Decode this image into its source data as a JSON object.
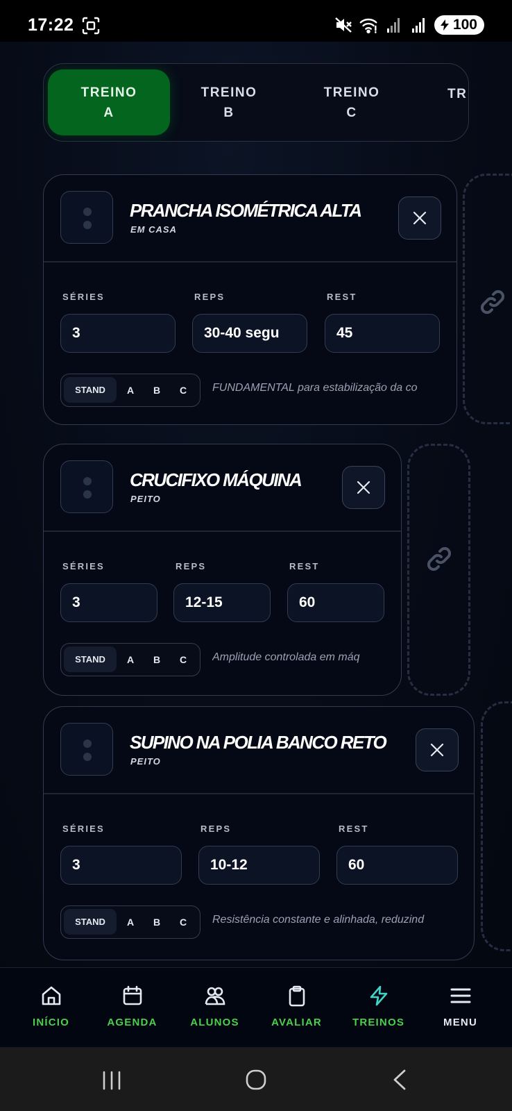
{
  "status_bar": {
    "time": "17:22",
    "battery": "100",
    "icons": [
      "screenshot-icon",
      "mute-icon",
      "wifi-icon",
      "signal-icon",
      "signal-icon",
      "battery-icon"
    ]
  },
  "tabs": [
    {
      "line1": "TREINO",
      "line2": "A",
      "active": true
    },
    {
      "line1": "TREINO",
      "line2": "B",
      "active": false
    },
    {
      "line1": "TREINO",
      "line2": "C",
      "active": false
    },
    {
      "line1": "TR",
      "line2": "",
      "active": false
    }
  ],
  "exercises": [
    {
      "name": "PRANCHA ISOMÉTRICA ALTA",
      "group": "EM CASA",
      "labels": {
        "series": "SÉRIES",
        "reps": "REPS",
        "rest": "REST"
      },
      "series": "3",
      "reps": "30-40 segu",
      "rest": "45",
      "techniques": [
        "STAND",
        "A",
        "B",
        "C"
      ],
      "selected_technique": "STAND",
      "note": "FUNDAMENTAL para estabilização da co"
    },
    {
      "name": "CRUCIFIXO MÁQUINA",
      "group": "PEITO",
      "labels": {
        "series": "SÉRIES",
        "reps": "REPS",
        "rest": "REST"
      },
      "series": "3",
      "reps": "12-15",
      "rest": "60",
      "techniques": [
        "STAND",
        "A",
        "B",
        "C"
      ],
      "selected_technique": "STAND",
      "note": "Amplitude controlada em máq"
    },
    {
      "name": "SUPINO NA POLIA BANCO RETO",
      "group": "PEITO",
      "labels": {
        "series": "SÉRIES",
        "reps": "REPS",
        "rest": "REST"
      },
      "series": "3",
      "reps": "10-12",
      "rest": "60",
      "techniques": [
        "STAND",
        "A",
        "B",
        "C"
      ],
      "selected_technique": "STAND",
      "note": "Resistência constante e alinhada, reduzind"
    }
  ],
  "bottom_nav": [
    {
      "label": "INÍCIO",
      "icon": "home-icon",
      "color": "#4ccf4c"
    },
    {
      "label": "AGENDA",
      "icon": "calendar-icon",
      "color": "#4ccf4c"
    },
    {
      "label": "ALUNOS",
      "icon": "users-icon",
      "color": "#4ccf4c"
    },
    {
      "label": "AVALIAR",
      "icon": "clipboard-icon",
      "color": "#4ccf4c"
    },
    {
      "label": "TREINOS",
      "icon": "bolt-icon",
      "color": "#4ccf4c",
      "active": true
    },
    {
      "label": "MENU",
      "icon": "menu-icon",
      "color": "#e6ebf2"
    }
  ],
  "colors": {
    "accent_green": "#04661e",
    "nav_green": "#4ccf4c",
    "active_icon_cyan": "#3fd6c8",
    "background": "#050916"
  }
}
